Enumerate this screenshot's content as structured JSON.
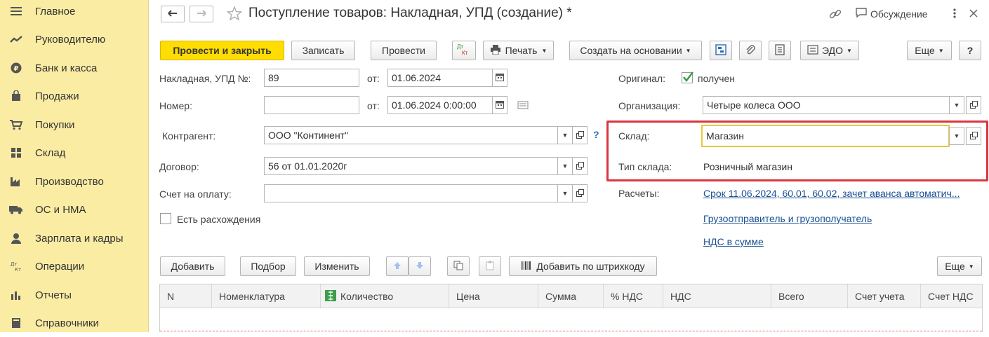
{
  "sidebar": {
    "items": [
      {
        "label": "Главное",
        "icon": "menu-lines-icon"
      },
      {
        "label": "Руководителю",
        "icon": "trend-chart-icon"
      },
      {
        "label": "Банк и касса",
        "icon": "ruble-coin-icon"
      },
      {
        "label": "Продажи",
        "icon": "shopping-bag-icon"
      },
      {
        "label": "Покупки",
        "icon": "shopping-cart-icon"
      },
      {
        "label": "Склад",
        "icon": "warehouse-grid-icon"
      },
      {
        "label": "Производство",
        "icon": "factory-icon"
      },
      {
        "label": "ОС и НМА",
        "icon": "truck-icon"
      },
      {
        "label": "Зарплата и кадры",
        "icon": "person-icon"
      },
      {
        "label": "Операции",
        "icon": "dt-kt-icon"
      },
      {
        "label": "Отчеты",
        "icon": "bar-chart-icon"
      },
      {
        "label": "Справочники",
        "icon": "book-icon"
      }
    ]
  },
  "header": {
    "title": "Поступление товаров: Накладная, УПД (создание) *",
    "discussion": "Обсуждение",
    "icons": [
      "back-arrow-icon",
      "forward-arrow-icon",
      "star-icon",
      "link-icon",
      "chat-bubble-icon",
      "more-vertical-icon",
      "close-icon"
    ]
  },
  "toolbar": {
    "post_close": "Провести и закрыть",
    "save": "Записать",
    "post": "Провести",
    "print": "Печать",
    "create_based": "Создать на основании",
    "edo": "ЭДО",
    "more": "Еще",
    "help": "?",
    "dtkt_top": "Дт",
    "dtkt_bottom": "Кт"
  },
  "form": {
    "invoice_label": "Накладная, УПД №:",
    "invoice_value": "89",
    "from_label": "от:",
    "invoice_date": "01.06.2024",
    "number_label": "Номер:",
    "number_value": "",
    "from_label2": "от:",
    "number_date": "01.06.2024  0:00:00",
    "counterparty_label": "Контрагент:",
    "counterparty_value": "ООО \"Континент\"",
    "help_mark": "?",
    "contract_label": "Договор:",
    "contract_value": "56 от 01.01.2020г",
    "invoice_pay_label": "Счет на оплату:",
    "invoice_pay_value": "",
    "discrepancies_label": "Есть расхождения",
    "discrepancies_checked": false,
    "original_label": "Оригинал:",
    "original_value": "получен",
    "original_checked": true,
    "organization_label": "Организация:",
    "organization_value": "Четыре колеса ООО",
    "warehouse_label": "Склад:",
    "warehouse_value": "Магазин",
    "warehouse_type_label": "Тип склада:",
    "warehouse_type_value": "Розничный магазин",
    "settlements_label": "Расчеты:",
    "settlements_link": "Срок 11.06.2024, 60.01, 60.02, зачет аванса автоматич...",
    "shipper_link": "Грузоотправитель и грузополучатель",
    "vat_link": "НДС в сумме"
  },
  "table_toolbar": {
    "add": "Добавить",
    "pick": "Подбор",
    "change": "Изменить",
    "add_barcode": "Добавить по штрихкоду",
    "more": "Еще"
  },
  "table": {
    "columns": [
      "N",
      "Номенклатура",
      "Количество",
      "Цена",
      "Сумма",
      "% НДС",
      "НДС",
      "Всего",
      "Счет учета",
      "Счет НДС"
    ],
    "rows": []
  },
  "colors": {
    "sidebar_bg": "#fbeca3",
    "primary_button": "#ffdd00",
    "highlight_border": "#d9363e",
    "link": "#1a4f93",
    "checkmark": "#2e9e3e"
  }
}
